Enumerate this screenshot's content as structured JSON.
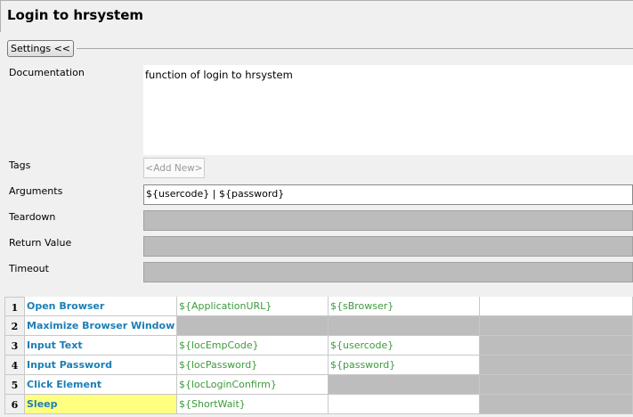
{
  "title": "Login to hrsystem",
  "settings_button": "Settings <<",
  "fields": {
    "documentation": {
      "label": "Documentation",
      "value": "function of login to hrsystem"
    },
    "tags": {
      "label": "Tags",
      "add_new": "<Add New>"
    },
    "arguments": {
      "label": "Arguments",
      "value": "${usercode} | ${password}"
    },
    "teardown": {
      "label": "Teardown",
      "value": ""
    },
    "return_value": {
      "label": "Return Value",
      "value": ""
    },
    "timeout": {
      "label": "Timeout",
      "value": ""
    }
  },
  "colors": {
    "keyword": "#1a7fb5",
    "argument": "#3b9b3b",
    "disabled": "#bdbdbd",
    "highlight": "#ffff80"
  },
  "steps": [
    {
      "num": "1",
      "keyword": "Open Browser",
      "args": [
        "${ApplicationURL}",
        "${sBrowser}",
        ""
      ]
    },
    {
      "num": "2",
      "keyword": "Maximize Browser Window",
      "args": [
        "",
        "",
        ""
      ]
    },
    {
      "num": "3",
      "keyword": "Input Text",
      "args": [
        "${locEmpCode}",
        "${usercode}",
        ""
      ]
    },
    {
      "num": "4",
      "keyword": "Input Password",
      "args": [
        "${locPassword}",
        "${password}",
        ""
      ]
    },
    {
      "num": "5",
      "keyword": "Click Element",
      "args": [
        "${locLoginConfirm}",
        "",
        ""
      ]
    },
    {
      "num": "6",
      "keyword": "Sleep",
      "args": [
        "${ShortWait}",
        "",
        ""
      ]
    }
  ]
}
